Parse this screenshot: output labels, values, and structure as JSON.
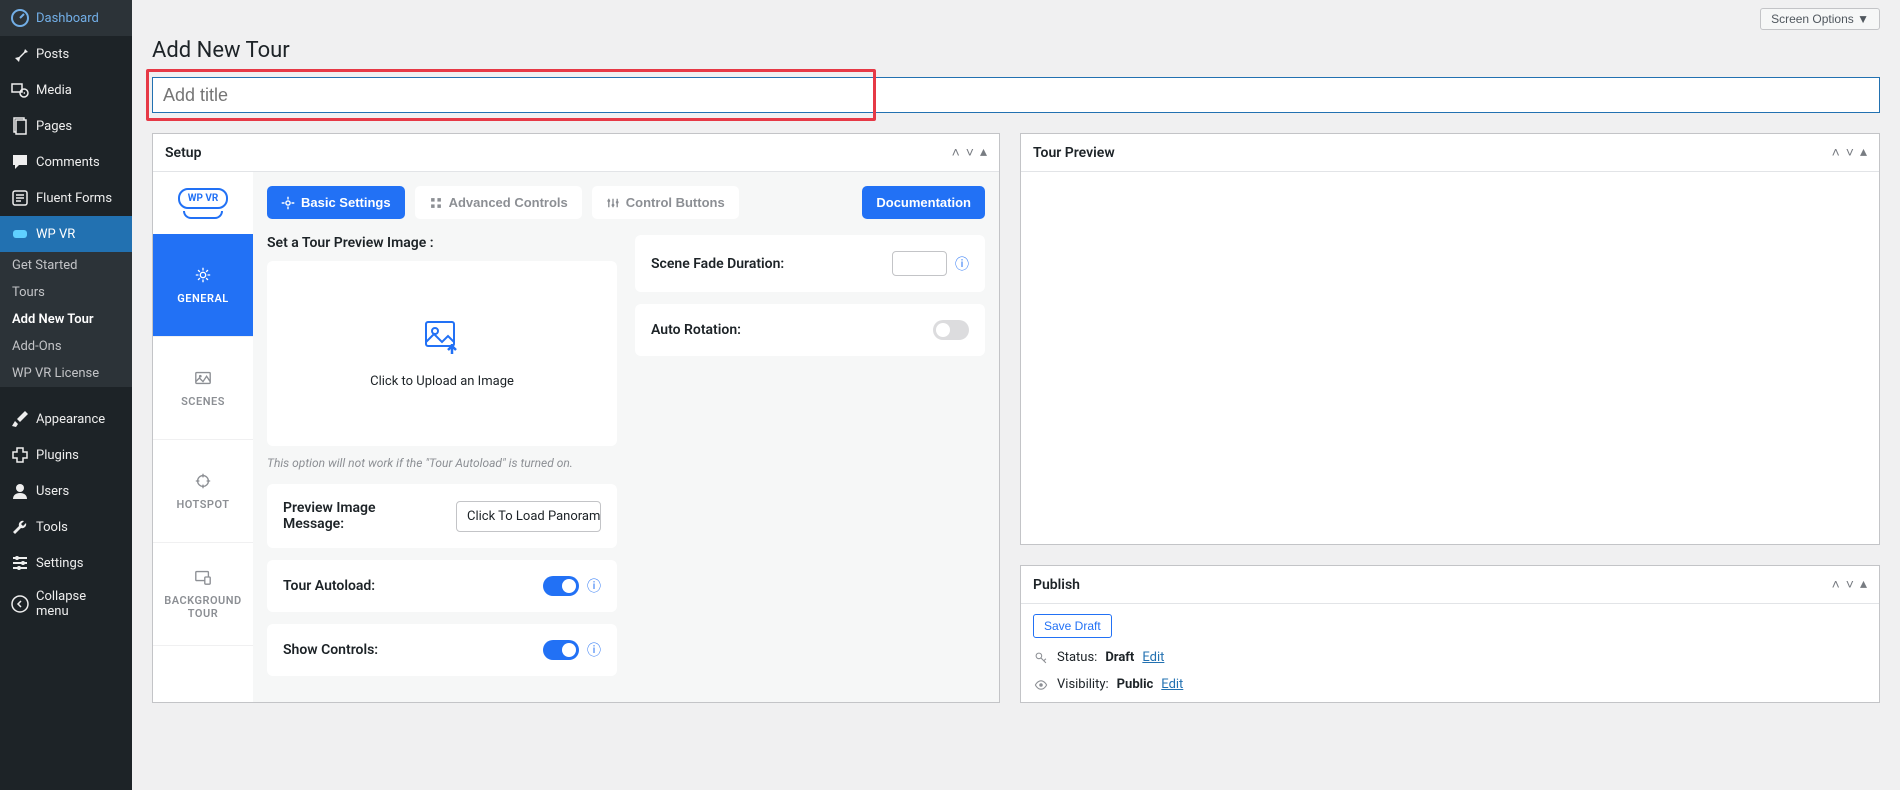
{
  "screen_options_label": "Screen Options",
  "page_title": "Add New Tour",
  "title_placeholder": "Add title",
  "sidebar": [
    {
      "icon": "dashboard",
      "label": "Dashboard"
    },
    {
      "icon": "pin",
      "label": "Posts"
    },
    {
      "icon": "media",
      "label": "Media"
    },
    {
      "icon": "page",
      "label": "Pages"
    },
    {
      "icon": "comment",
      "label": "Comments"
    },
    {
      "icon": "form",
      "label": "Fluent Forms"
    },
    {
      "icon": "wpvr",
      "label": "WP VR"
    }
  ],
  "submenu": [
    {
      "label": "Get Started"
    },
    {
      "label": "Tours"
    },
    {
      "label": "Add New Tour"
    },
    {
      "label": "Add-Ons"
    },
    {
      "label": "WP VR License"
    }
  ],
  "sidebar_bottom": [
    {
      "icon": "appearance",
      "label": "Appearance"
    },
    {
      "icon": "plugin",
      "label": "Plugins"
    },
    {
      "icon": "user",
      "label": "Users"
    },
    {
      "icon": "tool",
      "label": "Tools"
    },
    {
      "icon": "settings",
      "label": "Settings"
    },
    {
      "icon": "collapse",
      "label": "Collapse menu"
    }
  ],
  "setup": {
    "title": "Setup",
    "logo_text": "WP VR",
    "tabs": [
      "GENERAL",
      "SCENES",
      "HOTSPOT",
      "BACKGROUND TOUR"
    ],
    "topbar": {
      "basic": "Basic Settings",
      "advanced": "Advanced Controls",
      "control": "Control Buttons",
      "doc": "Documentation"
    },
    "preview_label": "Set a Tour Preview Image :",
    "upload_text": "Click to Upload an Image",
    "hint": "This option will not work if the \"Tour Autoload\" is turned on.",
    "preview_msg_label": "Preview Image Message:",
    "preview_msg_value": "Click To Load Panorama",
    "autoload_label": "Tour Autoload:",
    "controls_label": "Show Controls:",
    "fade_label": "Scene Fade Duration:",
    "rotation_label": "Auto Rotation:"
  },
  "tour_preview": {
    "title": "Tour Preview"
  },
  "publish": {
    "title": "Publish",
    "save_draft": "Save Draft",
    "status_label": "Status:",
    "status_value": "Draft",
    "visibility_label": "Visibility:",
    "visibility_value": "Public",
    "edit": "Edit"
  }
}
